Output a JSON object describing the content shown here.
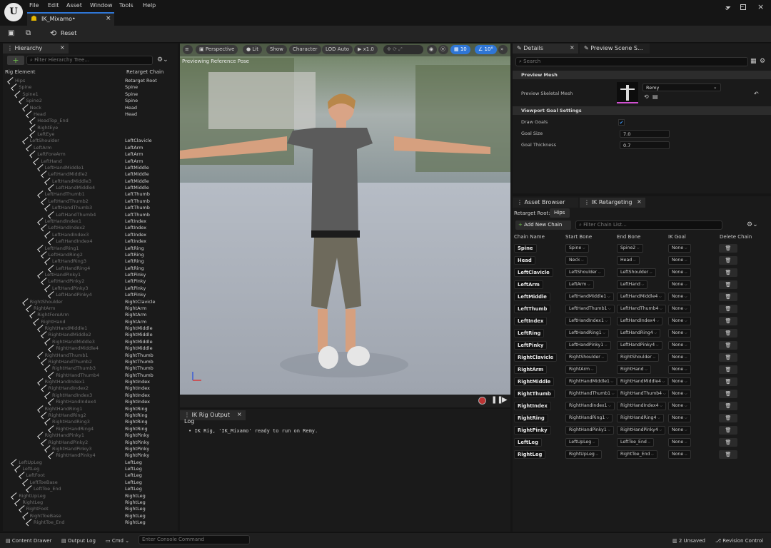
{
  "menu": [
    "File",
    "Edit",
    "Asset",
    "Window",
    "Tools",
    "Help"
  ],
  "asset_tab": "IK_Mixamo•",
  "toolbar": {
    "reset": "Reset"
  },
  "hierarchy": {
    "tab": "Hierarchy",
    "filter_placeholder": "Filter Hierarchy Tree...",
    "col_rig": "Rig Element",
    "col_chain": "Retarget Chain",
    "rows": [
      {
        "n": "Hips",
        "d": 0,
        "c": "Retarget Root"
      },
      {
        "n": "Spine",
        "d": 1,
        "c": "Spine"
      },
      {
        "n": "Spine1",
        "d": 2,
        "c": "Spine"
      },
      {
        "n": "Spine2",
        "d": 3,
        "c": "Spine"
      },
      {
        "n": "Neck",
        "d": 4,
        "c": "Head"
      },
      {
        "n": "Head",
        "d": 5,
        "c": "Head"
      },
      {
        "n": "HeadTop_End",
        "d": 6,
        "c": ""
      },
      {
        "n": "RightEye",
        "d": 6,
        "c": ""
      },
      {
        "n": "LeftEye",
        "d": 6,
        "c": ""
      },
      {
        "n": "LeftShoulder",
        "d": 4,
        "c": "LeftClavicle"
      },
      {
        "n": "LeftArm",
        "d": 5,
        "c": "LeftArm"
      },
      {
        "n": "LeftForeArm",
        "d": 6,
        "c": "LeftArm"
      },
      {
        "n": "LeftHand",
        "d": 7,
        "c": "LeftArm"
      },
      {
        "n": "LeftHandMiddle1",
        "d": 8,
        "c": "LeftMiddle"
      },
      {
        "n": "LeftHandMiddle2",
        "d": 9,
        "c": "LeftMiddle"
      },
      {
        "n": "LeftHandMiddle3",
        "d": 10,
        "c": "LeftMiddle"
      },
      {
        "n": "LeftHandMiddle4",
        "d": 11,
        "c": "LeftMiddle"
      },
      {
        "n": "LeftHandThumb1",
        "d": 8,
        "c": "LeftThumb"
      },
      {
        "n": "LeftHandThumb2",
        "d": 9,
        "c": "LeftThumb"
      },
      {
        "n": "LeftHandThumb3",
        "d": 10,
        "c": "LeftThumb"
      },
      {
        "n": "LeftHandThumb4",
        "d": 11,
        "c": "LeftThumb"
      },
      {
        "n": "LeftHandIndex1",
        "d": 8,
        "c": "LeftIndex"
      },
      {
        "n": "LeftHandIndex2",
        "d": 9,
        "c": "LeftIndex"
      },
      {
        "n": "LeftHandIndex3",
        "d": 10,
        "c": "LeftIndex"
      },
      {
        "n": "LeftHandIndex4",
        "d": 11,
        "c": "LeftIndex"
      },
      {
        "n": "LeftHandRing1",
        "d": 8,
        "c": "LeftRing"
      },
      {
        "n": "LeftHandRing2",
        "d": 9,
        "c": "LeftRing"
      },
      {
        "n": "LeftHandRing3",
        "d": 10,
        "c": "LeftRing"
      },
      {
        "n": "LeftHandRing4",
        "d": 11,
        "c": "LeftRing"
      },
      {
        "n": "LeftHandPinky1",
        "d": 8,
        "c": "LeftPinky"
      },
      {
        "n": "LeftHandPinky2",
        "d": 9,
        "c": "LeftPinky"
      },
      {
        "n": "LeftHandPinky3",
        "d": 10,
        "c": "LeftPinky"
      },
      {
        "n": "LeftHandPinky4",
        "d": 11,
        "c": "LeftPinky"
      },
      {
        "n": "RightShoulder",
        "d": 4,
        "c": "RightClavicle"
      },
      {
        "n": "RightArm",
        "d": 5,
        "c": "RightArm"
      },
      {
        "n": "RightForeArm",
        "d": 6,
        "c": "RightArm"
      },
      {
        "n": "RightHand",
        "d": 7,
        "c": "RightArm"
      },
      {
        "n": "RightHandMiddle1",
        "d": 8,
        "c": "RightMiddle"
      },
      {
        "n": "RightHandMiddle2",
        "d": 9,
        "c": "RightMiddle"
      },
      {
        "n": "RightHandMiddle3",
        "d": 10,
        "c": "RightMiddle"
      },
      {
        "n": "RightHandMiddle4",
        "d": 11,
        "c": "RightMiddle"
      },
      {
        "n": "RightHandThumb1",
        "d": 8,
        "c": "RightThumb"
      },
      {
        "n": "RightHandThumb2",
        "d": 9,
        "c": "RightThumb"
      },
      {
        "n": "RightHandThumb3",
        "d": 10,
        "c": "RightThumb"
      },
      {
        "n": "RightHandThumb4",
        "d": 11,
        "c": "RightThumb"
      },
      {
        "n": "RightHandIndex1",
        "d": 8,
        "c": "RightIndex"
      },
      {
        "n": "RightHandIndex2",
        "d": 9,
        "c": "RightIndex"
      },
      {
        "n": "RightHandIndex3",
        "d": 10,
        "c": "RightIndex"
      },
      {
        "n": "RightHandIndex4",
        "d": 11,
        "c": "RightIndex"
      },
      {
        "n": "RightHandRing1",
        "d": 8,
        "c": "RightRing"
      },
      {
        "n": "RightHandRing2",
        "d": 9,
        "c": "RightRing"
      },
      {
        "n": "RightHandRing3",
        "d": 10,
        "c": "RightRing"
      },
      {
        "n": "RightHandRing4",
        "d": 11,
        "c": "RightRing"
      },
      {
        "n": "RightHandPinky1",
        "d": 8,
        "c": "RightPinky"
      },
      {
        "n": "RightHandPinky2",
        "d": 9,
        "c": "RightPinky"
      },
      {
        "n": "RightHandPinky3",
        "d": 10,
        "c": "RightPinky"
      },
      {
        "n": "RightHandPinky4",
        "d": 11,
        "c": "RightPinky"
      },
      {
        "n": "LeftUpLeg",
        "d": 1,
        "c": "LeftLeg"
      },
      {
        "n": "LeftLeg",
        "d": 2,
        "c": "LeftLeg"
      },
      {
        "n": "LeftFoot",
        "d": 3,
        "c": "LeftLeg"
      },
      {
        "n": "LeftToeBase",
        "d": 4,
        "c": "LeftLeg"
      },
      {
        "n": "LeftToe_End",
        "d": 5,
        "c": "LeftLeg"
      },
      {
        "n": "RightUpLeg",
        "d": 1,
        "c": "RightLeg"
      },
      {
        "n": "RightLeg",
        "d": 2,
        "c": "RightLeg"
      },
      {
        "n": "RightFoot",
        "d": 3,
        "c": "RightLeg"
      },
      {
        "n": "RightToeBase",
        "d": 4,
        "c": "RightLeg"
      },
      {
        "n": "RightToe_End",
        "d": 5,
        "c": "RightLeg"
      }
    ]
  },
  "viewport": {
    "perspective": "Perspective",
    "lit": "Lit",
    "show": "Show",
    "character": "Character",
    "lod": "LOD Auto",
    "speed": "x1.0",
    "grid": "10",
    "angle": "10°",
    "overlay": "Previewing Reference Pose"
  },
  "log": {
    "tab": "IK Rig Output Log",
    "message": "IK Rig, 'IK_Mixamo' ready to run on Remy."
  },
  "details": {
    "tab": "Details",
    "tab2": "Preview Scene S...",
    "search_placeholder": "Search",
    "sect_mesh": "Preview Mesh",
    "mesh_label": "Preview Skeletal Mesh",
    "mesh_value": "Remy",
    "sect_goal": "Viewport Goal Settings",
    "draw_goals": "Draw Goals",
    "goal_size": "Goal Size",
    "goal_size_val": "7.0",
    "goal_thick": "Goal Thickness",
    "goal_thick_val": "0.7"
  },
  "ik": {
    "tab_asset": "Asset Browser",
    "tab_ik": "IK Retargeting",
    "root_label": "Retarget Root:",
    "root_value": "Hips",
    "add_chain": "Add New Chain",
    "filter_placeholder": "Filter Chain List...",
    "cols": [
      "Chain Name",
      "Start Bone",
      "End Bone",
      "IK Goal",
      "Delete Chain"
    ],
    "chains": [
      [
        "Spine",
        "Spine",
        "Spine2",
        "None"
      ],
      [
        "Head",
        "Neck",
        "Head",
        "None"
      ],
      [
        "LeftClavicle",
        "LeftShoulder",
        "LeftShoulder",
        "None"
      ],
      [
        "LeftArm",
        "LeftArm",
        "LeftHand",
        "None"
      ],
      [
        "LeftMiddle",
        "LeftHandMiddle1",
        "LeftHandMiddle4",
        "None"
      ],
      [
        "LeftThumb",
        "LeftHandThumb1",
        "LeftHandThumb4",
        "None"
      ],
      [
        "LeftIndex",
        "LeftHandIndex1",
        "LeftHandIndex4",
        "None"
      ],
      [
        "LeftRing",
        "LeftHandRing1",
        "LeftHandRing4",
        "None"
      ],
      [
        "LeftPinky",
        "LeftHandPinky1",
        "LeftHandPinky4",
        "None"
      ],
      [
        "RightClavicle",
        "RightShoulder",
        "RightShoulder",
        "None"
      ],
      [
        "RightArm",
        "RightArm",
        "RightHand",
        "None"
      ],
      [
        "RightMiddle",
        "RightHandMiddle1",
        "RightHandMiddle4",
        "None"
      ],
      [
        "RightThumb",
        "RightHandThumb1",
        "RightHandThumb4",
        "None"
      ],
      [
        "RightIndex",
        "RightHandIndex1",
        "RightHandIndex4",
        "None"
      ],
      [
        "RightRing",
        "RightHandRing1",
        "RightHandRing4",
        "None"
      ],
      [
        "RightPinky",
        "RightHandPinky1",
        "RightHandPinky4",
        "None"
      ],
      [
        "LeftLeg",
        "LeftUpLeg",
        "LeftToe_End",
        "None"
      ],
      [
        "RightLeg",
        "RightUpLeg",
        "RightToe_End",
        "None"
      ]
    ]
  },
  "status": {
    "drawer": "Content Drawer",
    "output": "Output Log",
    "cmd": "Cmd",
    "console_placeholder": "Enter Console Command",
    "unsaved": "2 Unsaved",
    "revision": "Revision Control"
  }
}
